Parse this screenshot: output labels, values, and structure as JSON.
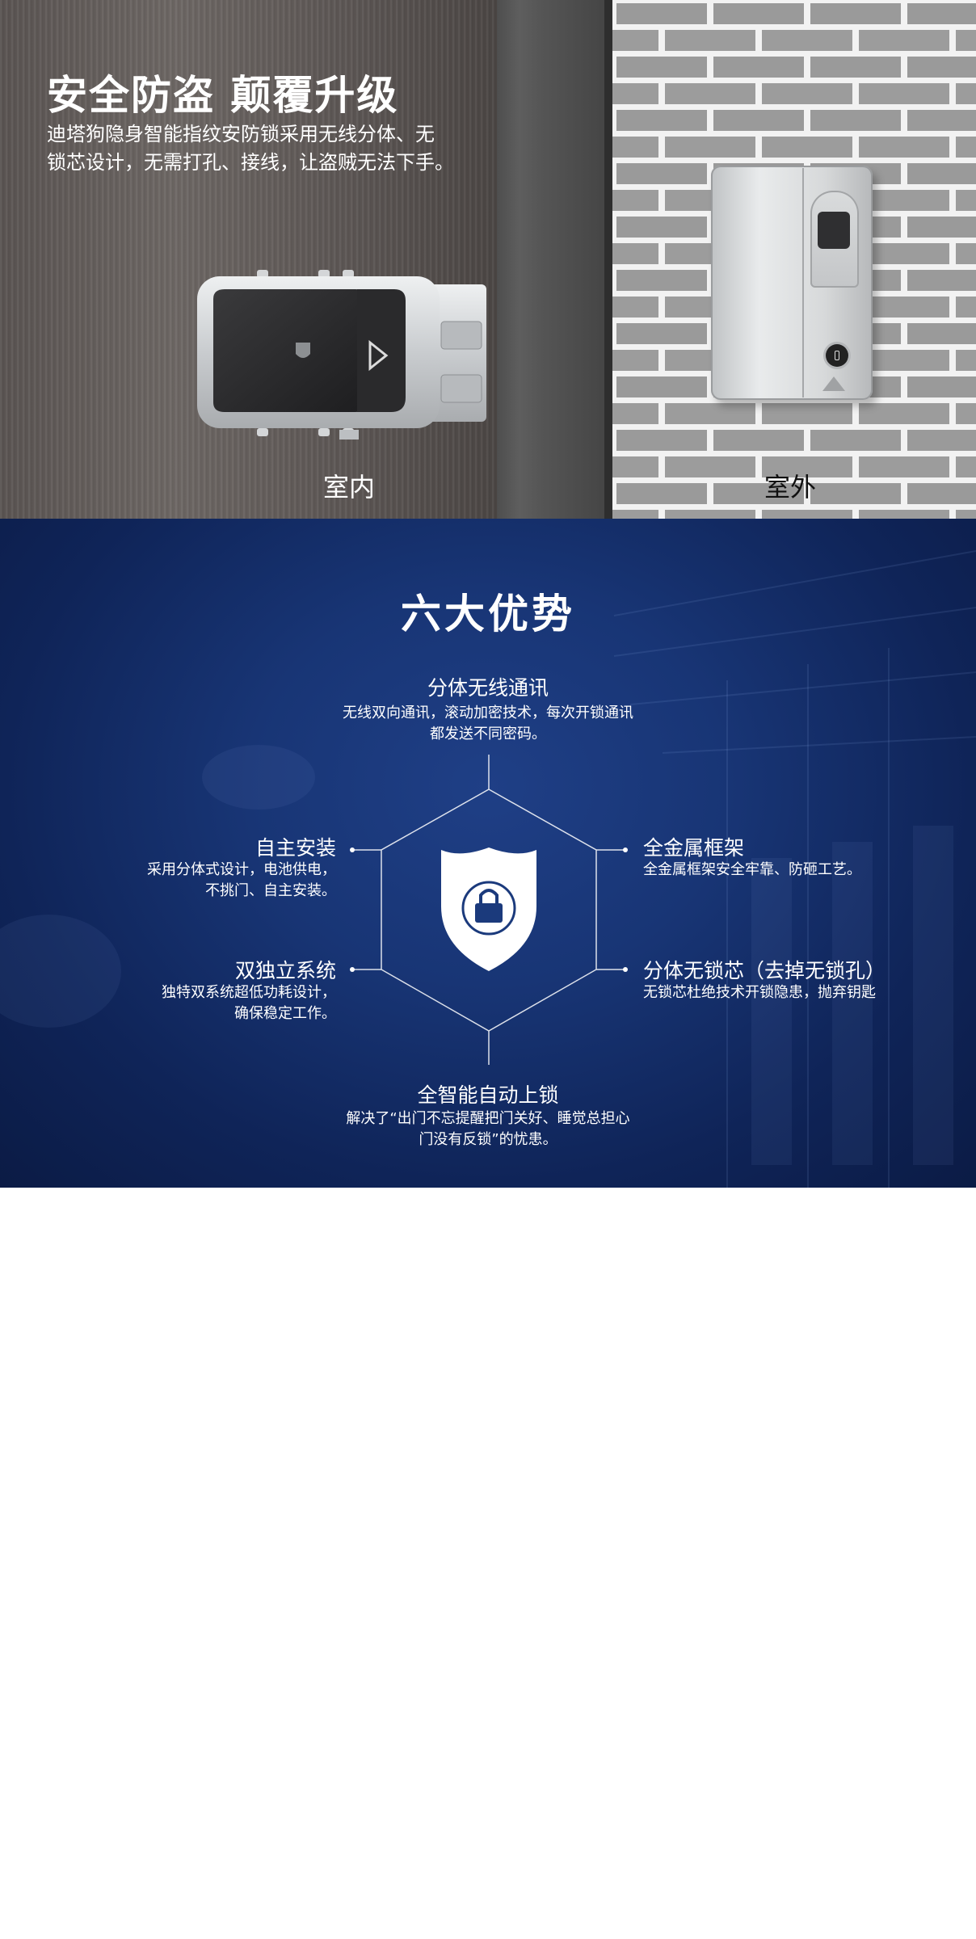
{
  "hero": {
    "headline": "安全防盗 颠覆升级",
    "subline_1": "迪塔狗隐身智能指纹安防锁采用无线分体、无",
    "subline_2": "锁芯设计，无需打孔、接线，让盗贼无法下手。",
    "label_indoor": "室内",
    "label_outdoor": "室外"
  },
  "advantages": {
    "title": "六大优势",
    "features": [
      {
        "title": "分体无线通讯",
        "desc_1": "无线双向通讯，滚动加密技术，每次开锁通讯",
        "desc_2": "都发送不同密码。"
      },
      {
        "title": "自主安装",
        "desc_1": "采用分体式设计，电池供电，",
        "desc_2": "不挑门、自主安装。"
      },
      {
        "title": "全金属框架",
        "desc_1": "全金属框架安全牢靠、防砸工艺。"
      },
      {
        "title": "双独立系统",
        "desc_1": "独特双系统超低功耗设计，",
        "desc_2": "确保稳定工作。"
      },
      {
        "title": "分体无锁芯（去掉无锁孔）",
        "desc_1": "无锁芯杜绝技术开锁隐患，抛弃钥匙"
      },
      {
        "title": "全智能自动上锁",
        "desc_1": "解决了“出门不忘提醒把门关好、睡觉总担心",
        "desc_2": "门没有反锁”的忧患。"
      }
    ]
  },
  "colors": {
    "advantage_bg": "#163170",
    "text": "#ffffff"
  },
  "icons": [
    "shield-lock-icon",
    "fingerprint-icon",
    "lock-icon"
  ]
}
